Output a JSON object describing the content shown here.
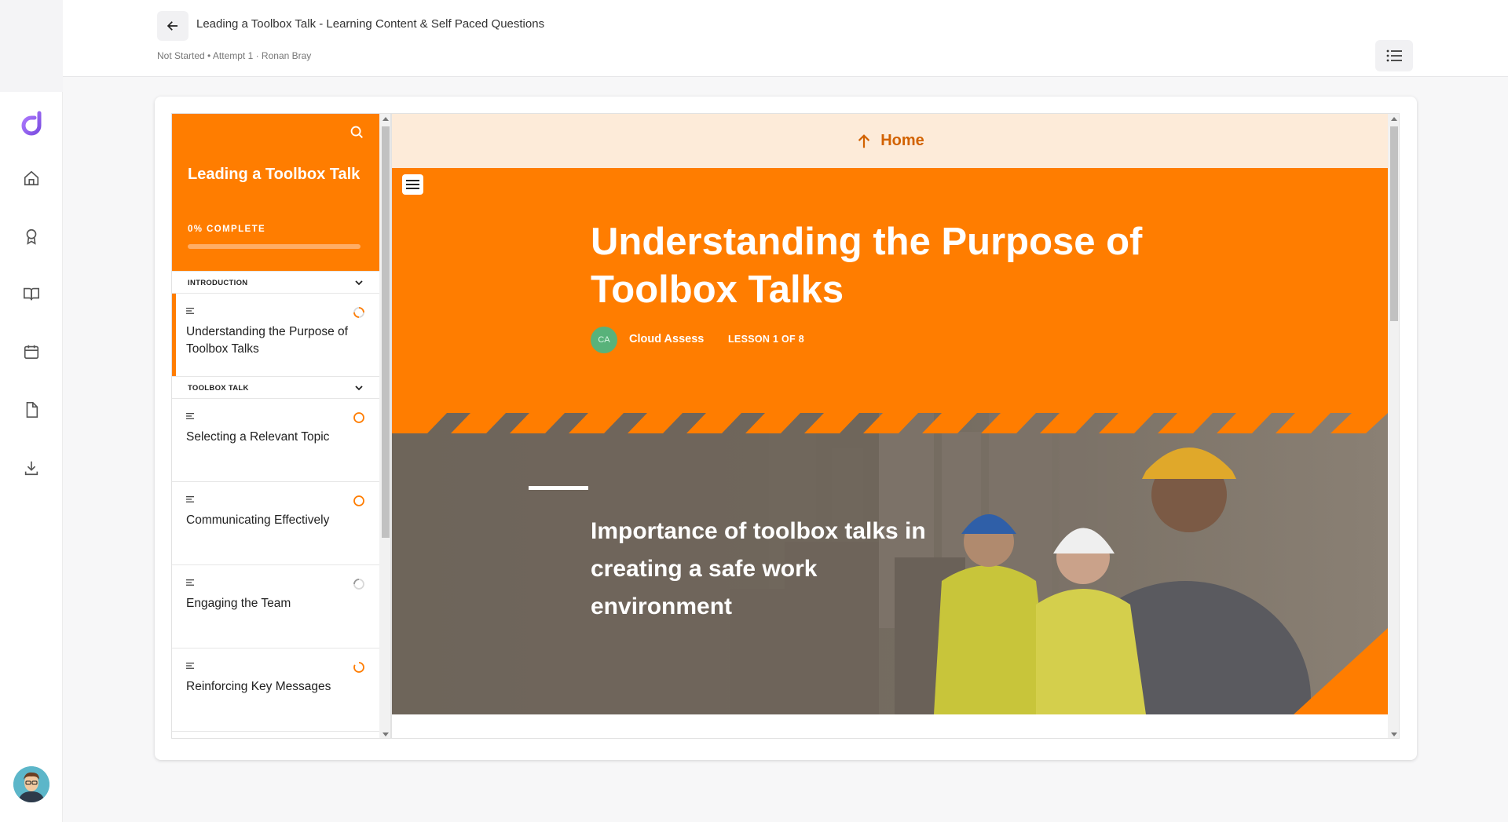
{
  "header": {
    "title": "Leading a Toolbox Talk - Learning Content & Self Paced Questions",
    "subtitle": "Not Started • Attempt 1 · Ronan Bray"
  },
  "rail": {
    "logo_icon": "cloud-assess-logo-icon",
    "items": [
      {
        "icon": "home-icon"
      },
      {
        "icon": "award-icon"
      },
      {
        "icon": "book-icon"
      },
      {
        "icon": "calendar-icon"
      },
      {
        "icon": "document-icon"
      },
      {
        "icon": "download-icon"
      }
    ],
    "avatar_icon": "user-avatar"
  },
  "course": {
    "title": "Leading a Toolbox Talk",
    "progress_label": "0% COMPLETE",
    "progress": 0,
    "sections": [
      {
        "label": "INTRODUCTION",
        "lessons": [
          {
            "label": "Understanding the Purpose of Toolbox Talks",
            "active": true
          }
        ]
      },
      {
        "label": "TOOLBOX TALK",
        "lessons": [
          {
            "label": "Selecting a Relevant Topic",
            "active": false
          },
          {
            "label": "Communicating Effectively",
            "active": false
          },
          {
            "label": "Engaging the Team",
            "active": false
          },
          {
            "label": "Reinforcing Key Messages",
            "active": false
          }
        ]
      }
    ]
  },
  "lesson": {
    "home_label": "Home",
    "title": "Understanding the Purpose of Toolbox Talks",
    "author_initials": "CA",
    "author": "Cloud Assess",
    "lesson_count": "LESSON 1 OF 8",
    "subheading": "Importance of toolbox talks in creating a safe work environment"
  },
  "colors": {
    "accent": "#ff7d00",
    "home_bar": "#fdebd9",
    "home_text": "#d26200",
    "brand_purple": "#8b5cf6"
  }
}
